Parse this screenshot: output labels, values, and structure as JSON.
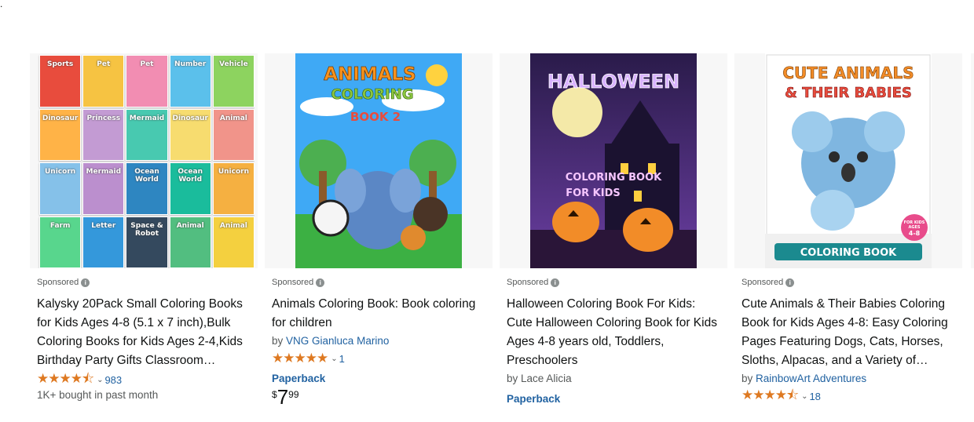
{
  "top_glyph": ".",
  "products": [
    {
      "sponsored_label": "Sponsored",
      "title": "Kalysky 20Pack Small Coloring Books for Kids Ages 4-8 (5.1 x 7 inch),Bulk Coloring Books for Kids Ages 2-4,Kids Birthday Party Gifts Classroom…",
      "rating_stars": "★★★★⯪",
      "review_count": "983",
      "bought_text": "1K+ bought in past month",
      "cover": {
        "tiles": [
          "Sports",
          "Pet",
          "Pet",
          "Number",
          "Vehicle",
          "Dinosaur",
          "Princess",
          "Mermaid",
          "Dinosaur",
          "Animal",
          "Unicorn",
          "Mermaid",
          "Ocean World",
          "Ocean World",
          "Unicorn",
          "Farm",
          "Letter",
          "Space & Robot",
          "Animal",
          "Animal"
        ],
        "colors": [
          "#e84c3d",
          "#f6c342",
          "#f28db2",
          "#5bc0eb",
          "#8dd35f",
          "#ffb347",
          "#c39bd3",
          "#48c9b0",
          "#f7dc6f",
          "#f1948a",
          "#85c1e9",
          "#bb8fce",
          "#2e86c1",
          "#1abc9c",
          "#f5b041",
          "#58d68d",
          "#3498db",
          "#34495e",
          "#52be80",
          "#f4d03f"
        ]
      }
    },
    {
      "sponsored_label": "Sponsored",
      "title": "Animals Coloring Book: Book coloring for children",
      "by_prefix": "by",
      "author": "VNG Gianluca Marino",
      "rating_stars": "★★★★★",
      "review_count": "1",
      "format": "Paperback",
      "price_symbol": "$",
      "price_whole": "7",
      "price_fraction": "99",
      "cover": {
        "line1": "ANIMALS",
        "line2": "COLORING",
        "line3": "BOOK 2"
      }
    },
    {
      "sponsored_label": "Sponsored",
      "title": "Halloween Coloring Book For Kids: Cute Halloween Coloring Book for Kids Ages 4-8 years old, Toddlers, Preschoolers",
      "by_prefix": "by",
      "author": "Lace Alicia",
      "format": "Paperback",
      "cover": {
        "line1": "HALLOWEEN",
        "line2": "COLORING BOOK",
        "line3": "FOR KIDS"
      }
    },
    {
      "sponsored_label": "Sponsored",
      "title": "Cute Animals & Their Babies Coloring Book for Kids Ages 4-8: Easy Coloring Pages Featuring Dogs, Cats, Horses, Sloths, Alpacas, and a Variety of…",
      "by_prefix": "by",
      "author": "RainbowArt Adventures",
      "rating_stars": "★★★★⯪",
      "review_count": "18",
      "cover": {
        "line1": "CUTE ANIMALS",
        "line2": "& THEIR BABIES",
        "line3": "COLORING BOOK",
        "badge1": "FOR KIDS",
        "badge2": "AGES",
        "badge3": "4-8"
      }
    }
  ]
}
